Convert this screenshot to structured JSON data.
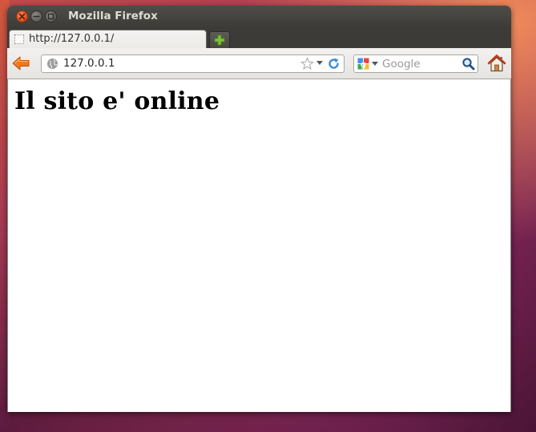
{
  "window": {
    "title": "Mozilla Firefox"
  },
  "tabs": [
    {
      "title": "http://127.0.0.1/",
      "active": true
    }
  ],
  "navbar": {
    "url": "127.0.0.1",
    "search_placeholder": "Google"
  },
  "page": {
    "heading": "Il sito e' online"
  },
  "icons": {
    "window_controls": [
      "close-icon",
      "minimize-icon",
      "maximize-icon"
    ],
    "tab_favicon": "blank-page-icon",
    "new_tab": "plus-icon",
    "back": "back-arrow-icon",
    "site_identity": "globe-icon",
    "bookmark": "star-icon",
    "reload": "reload-icon",
    "search_engine": "google-icon",
    "search_go": "magnifier-icon",
    "home": "home-icon"
  },
  "colors": {
    "titlebar": "#3c3b37",
    "close_button": "#e45420",
    "back_arrow": "#f0781e",
    "new_tab_plus": "#7cc23a",
    "reload": "#3f8fd0"
  }
}
